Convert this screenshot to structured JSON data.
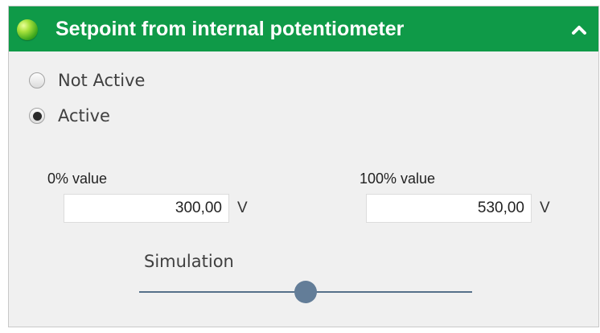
{
  "panel": {
    "title": "Setpoint from internal potentiometer",
    "status_icon": "green-status-light-icon",
    "collapse_icon": "chevron-up-icon",
    "header_color": "#0f9a48"
  },
  "mode": {
    "options": [
      {
        "label": "Not Active",
        "selected": false
      },
      {
        "label": "Active",
        "selected": true
      }
    ]
  },
  "fields": {
    "zero": {
      "label": "0% value",
      "value": "300,00",
      "unit": "V"
    },
    "hundred": {
      "label": "100% value",
      "value": "530,00",
      "unit": "V"
    }
  },
  "simulation": {
    "label": "Simulation",
    "position_fraction": 0.5
  }
}
